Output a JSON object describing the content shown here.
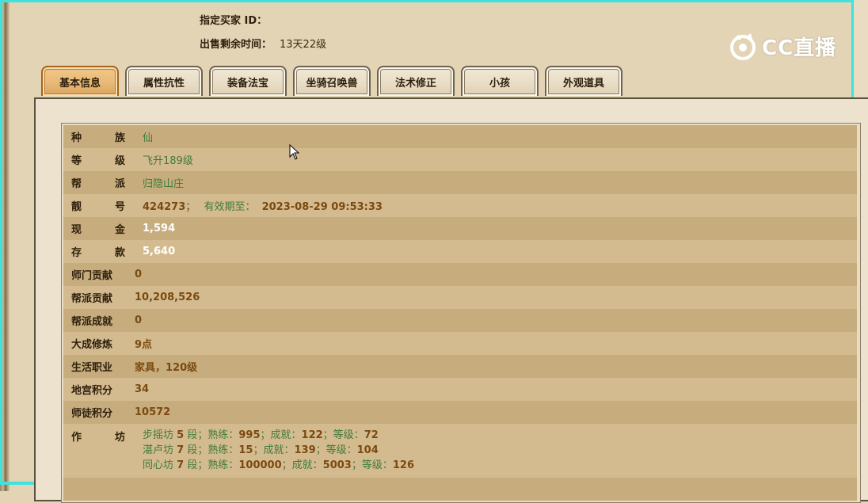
{
  "header": {
    "buyer_id_label": "指定买家 ID：",
    "buyer_id_value": "",
    "remaining_label": "出售剩余时间：",
    "remaining_value": "13天22级"
  },
  "logo": {
    "text": "CC直播"
  },
  "tabs": [
    {
      "label": "基本信息",
      "active": true
    },
    {
      "label": "属性抗性"
    },
    {
      "label": "装备法宝"
    },
    {
      "label": "坐骑召唤兽"
    },
    {
      "label": "法术修正"
    },
    {
      "label": "小孩"
    },
    {
      "label": "外观道具"
    }
  ],
  "rows": {
    "race": {
      "label_a": "种",
      "label_b": "族",
      "value": "仙"
    },
    "level": {
      "label_a": "等",
      "label_b": "级",
      "value": "飞升189级"
    },
    "guild": {
      "label_a": "帮",
      "label_b": "派",
      "value": "归隐山庄"
    },
    "lucky": {
      "label_a": "靓",
      "label_b": "号",
      "value": "424273",
      "sep": "；",
      "expire_label": "有效期至：",
      "expire_value": "2023-08-29 09:53:33"
    },
    "cash": {
      "label_a": "现",
      "label_b": "金",
      "value": "1,594"
    },
    "deposit": {
      "label_a": "存",
      "label_b": "款",
      "value": "5,640"
    },
    "sect_contrib": {
      "label": "师门贡献",
      "value": "0"
    },
    "guild_contrib": {
      "label": "帮派贡献",
      "value": "10,208,526"
    },
    "guild_achieve": {
      "label": "帮派成就",
      "value": "0"
    },
    "cultivation": {
      "label": "大成修炼",
      "value": "9点"
    },
    "life_job": {
      "label": "生活职业",
      "value": "家具，120级"
    },
    "palace_points": {
      "label": "地宫积分",
      "value": "34"
    },
    "mentor_points": {
      "label": "师徒积分",
      "value": "10572"
    },
    "workshop": {
      "label_a": "作",
      "label_b": "坊",
      "lines": [
        {
          "name": "步摇坊",
          "stage": "5",
          "stage_u": "段；",
          "skill_l": "熟练：",
          "skill": "995",
          "ach_l": "；成就：",
          "ach": "122",
          "lvl_l": "；等级：",
          "lvl": "72"
        },
        {
          "name": "湛卢坊",
          "stage": "7",
          "stage_u": "段；",
          "skill_l": "熟练：",
          "skill": "15",
          "ach_l": "；成就：",
          "ach": "139",
          "lvl_l": "；等级：",
          "lvl": "104"
        },
        {
          "name": "同心坊",
          "stage": "7",
          "stage_u": "段；",
          "skill_l": "熟练：",
          "skill": "100000",
          "ach_l": "；成就：",
          "ach": "5003",
          "lvl_l": "；等级：",
          "lvl": "126"
        }
      ]
    }
  },
  "colors": {
    "accent_cyan": "#3de3dc",
    "tab_active": "#e9b977",
    "row_odd": "#c7ad7d",
    "row_even": "#d4bb8f",
    "value_green": "#3f7a3a",
    "value_brown": "#7a4a10"
  }
}
